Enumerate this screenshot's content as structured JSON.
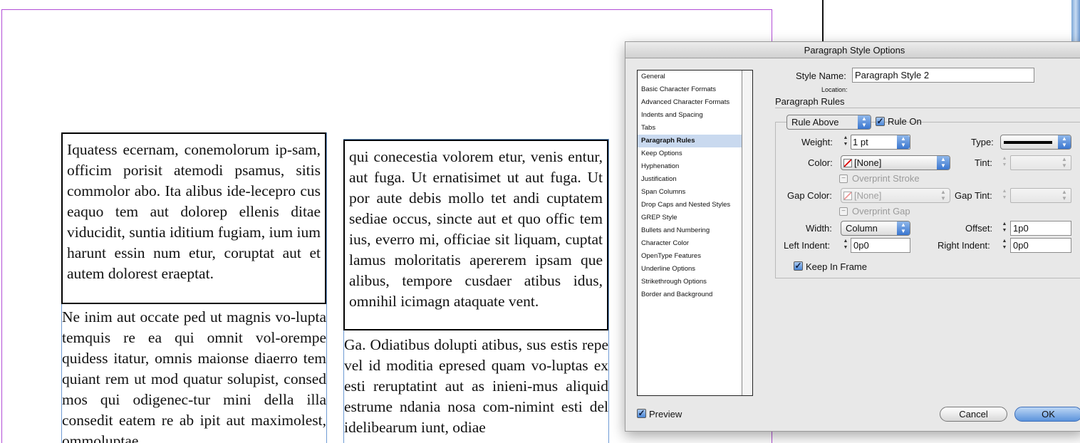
{
  "document": {
    "col1_ruled": "Iquatess ecernam, conemolorum ip-sam, officim porisit atemodi psamus, sitis commolor abo. Ita alibus ide-lecepro cus eaquo tem aut dolorep ellenis ditae viducidit, suntia iditium fugiam, ium ium harunt essin num etur, coruptat aut et autem dolorest eraeptat.",
    "col1_body": "Ne inim aut occate ped ut magnis vo-lupta temquis re ea qui omnit vol-orempe quidess itatur, omnis maionse diaerro tem quiant rem ut mod quatur solupist, consed mos qui odigenec-tur mini della illa consedit eatem re ab ipit aut maximolest, ommoluptae",
    "col2_ruled": "qui conecestia volorem etur, venis entur, aut fuga. Ut ernatisimet ut aut fuga. Ut por aute debis mollo tet andi cuptatem sediae occus, sincte aut et quo offic tem ius, everro mi, officiae sit liquam, cuptat lamus moloritatis apererem ipsam que alibus, tempore cusdaer atibus idus, omnihil icimagn ataquate vent.",
    "col2_body": "Ga. Odiatibus dolupti atibus, sus estis repe vel id moditia epresed quam vo-luptas ex esti reruptatint aut as inieni-mus aliquid estrume ndania nosa com-nimint esti del idelibearum iunt, odiae"
  },
  "dialog": {
    "title": "Paragraph Style Options",
    "categories": [
      "General",
      "Basic Character Formats",
      "Advanced Character Formats",
      "Indents and Spacing",
      "Tabs",
      "Paragraph Rules",
      "Keep Options",
      "Hyphenation",
      "Justification",
      "Span Columns",
      "Drop Caps and Nested Styles",
      "GREP Style",
      "Bullets and Numbering",
      "Character Color",
      "OpenType Features",
      "Underline Options",
      "Strikethrough Options",
      "Border and Background"
    ],
    "selected_category": "Paragraph Rules",
    "style_name_label": "Style Name:",
    "style_name_value": "Paragraph Style 2",
    "location_label": "Location:",
    "section_title": "Paragraph Rules",
    "rule_select": "Rule Above",
    "rule_on_label": "Rule On",
    "rule_on_checked": true,
    "weight_label": "Weight:",
    "weight_value": "1 pt",
    "type_label": "Type:",
    "color_label": "Color:",
    "color_value": "[None]",
    "tint_label": "Tint:",
    "overprint_stroke_label": "Overprint Stroke",
    "gap_color_label": "Gap Color:",
    "gap_color_value": "[None]",
    "gap_tint_label": "Gap Tint:",
    "overprint_gap_label": "Overprint Gap",
    "width_label": "Width:",
    "width_value": "Column",
    "offset_label": "Offset:",
    "offset_value": "1p0",
    "left_indent_label": "Left Indent:",
    "left_indent_value": "0p0",
    "right_indent_label": "Right Indent:",
    "right_indent_value": "0p0",
    "keep_in_frame_label": "Keep In Frame",
    "keep_in_frame_checked": true,
    "preview_label": "Preview",
    "preview_checked": true,
    "cancel_label": "Cancel",
    "ok_label": "OK",
    "colors": {
      "rule_frame": "#000000",
      "margin_guide": "#b24dd6",
      "text_frame_edge": "#6f9bd4",
      "selected_category_bg": "#c9d9ef",
      "aqua_accent": "#3a76d0"
    }
  }
}
